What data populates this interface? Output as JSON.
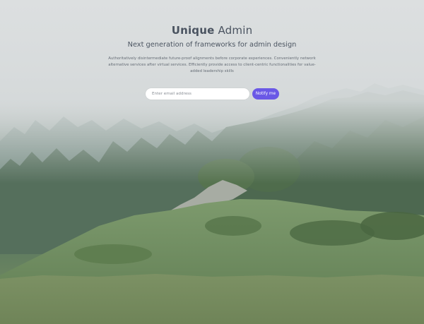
{
  "brand": {
    "bold": "Unique",
    "light": "Admin"
  },
  "tagline": "Next generation of frameworks for admin design",
  "description": "Authoritatively disintermediate future-proof alignments before corporate experiences. Conveniently network alternative services after virtual services. Efficiently provide access to client-centric functionalities for value-added leadership skills",
  "subscribe": {
    "placeholder": "Enter email address",
    "value": "",
    "button_label": "Notify me"
  },
  "colors": {
    "accent": "#6a58e6",
    "heading": "#4a5360",
    "body_text": "#666d76"
  }
}
